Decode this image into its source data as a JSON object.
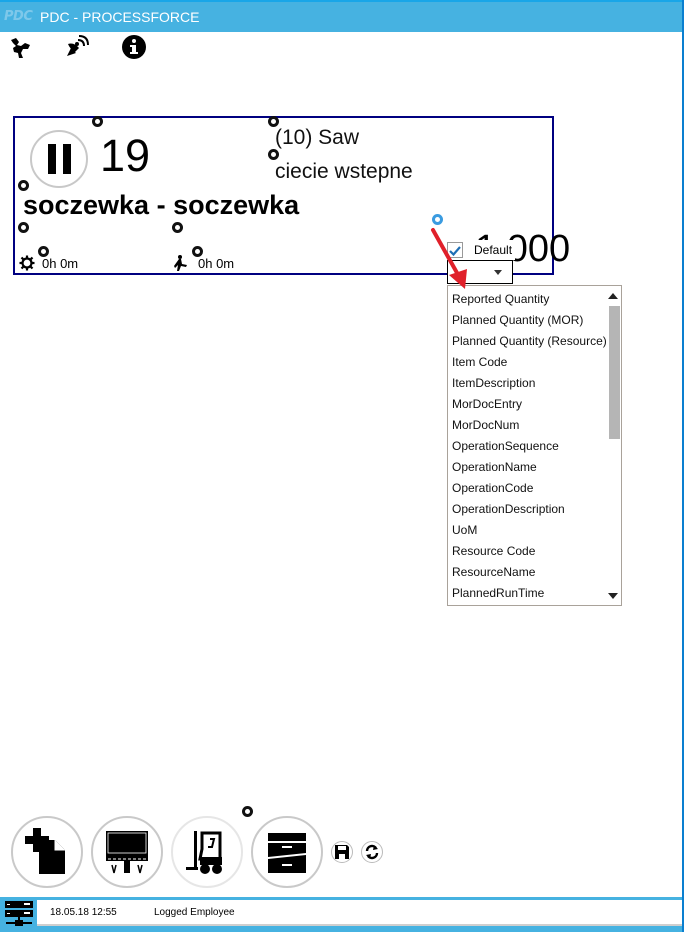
{
  "window": {
    "logo": "PDC",
    "title": "PDC - PROCESSFORCE"
  },
  "toolbar": {
    "icons": [
      "robot-arm-icon",
      "satellite-dish-icon",
      "info-icon"
    ]
  },
  "operation_card": {
    "order_number": "19",
    "operation_code": "(10) Saw",
    "operation_description": "ciecie wstepne",
    "item": "soczewka - soczewka",
    "setup_time": "0h 0m",
    "run_time": "0h 0m",
    "quantity": "1.000",
    "status": "paused"
  },
  "field_picker": {
    "default_label": "Default",
    "default_checked": true,
    "selected_value": "",
    "options": [
      "Reported Quantity",
      "Planned Quantity (MOR)",
      "Planned Quantity (Resource)",
      "Item Code",
      "ItemDescription",
      "MorDocEntry",
      "MorDocNum",
      "OperationSequence",
      "OperationName",
      "OperationCode",
      "OperationDescription",
      "UoM",
      "Resource Code",
      "ResourceName",
      "PlannedRunTime"
    ]
  },
  "bottom_buttons": [
    "new-document",
    "billboard",
    "forklift",
    "archive-cabinet",
    "save",
    "refresh"
  ],
  "statusbar": {
    "datetime": "18.05.18 12:55",
    "user": "Logged Employee"
  },
  "colors": {
    "accent": "#46b2e1",
    "card_border": "#000080",
    "annotation_arrow": "#e0202a"
  }
}
